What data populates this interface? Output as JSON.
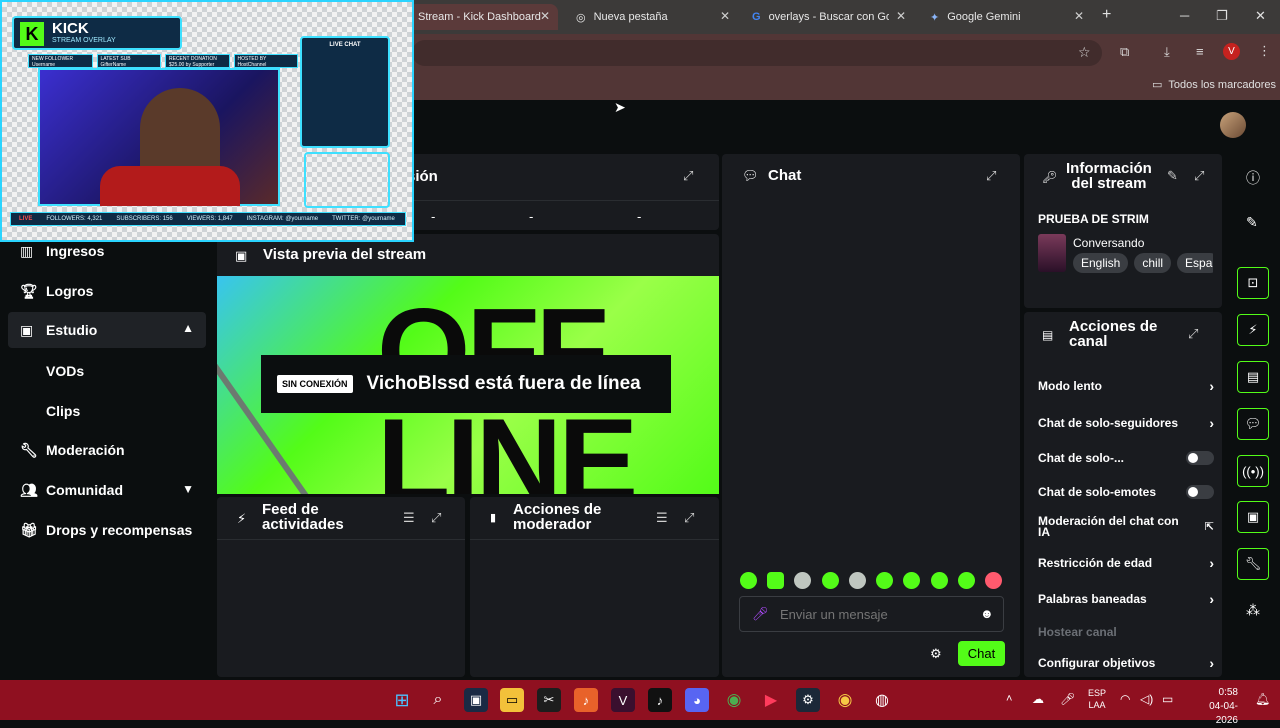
{
  "browser": {
    "tabs": [
      {
        "title": "Stream - Kick Dashboard",
        "active": true
      },
      {
        "title": "Nueva pestaña",
        "active": false
      },
      {
        "title": "overlays - Buscar con Goo",
        "active": false
      },
      {
        "title": "Google Gemini",
        "active": false
      }
    ],
    "new_tab": "+",
    "bookmarks_label": "Todos los marcadores",
    "profile_initial": "V"
  },
  "sidebar": {
    "items": [
      {
        "label": "Ingresos",
        "icon": "bar-chart-icon"
      },
      {
        "label": "Logros",
        "icon": "trophy-icon"
      },
      {
        "label": "Estudio",
        "icon": "video-icon"
      },
      {
        "label": "VODs"
      },
      {
        "label": "Clips"
      },
      {
        "label": "Moderación",
        "icon": "wrench-icon"
      },
      {
        "label": "Comunidad",
        "icon": "users-icon"
      },
      {
        "label": "Drops y recompensas",
        "icon": "gift-icon"
      }
    ]
  },
  "session": {
    "title_fragment": "sión",
    "stats": [
      "-",
      "-",
      "-"
    ]
  },
  "preview": {
    "title": "Vista previa del stream",
    "badge": "SIN CONEXIÓN",
    "offline_text": "VichoBlssd está fuera de línea"
  },
  "activity": {
    "title_line1": "Feed de",
    "title_line2": "actividades"
  },
  "moderator": {
    "title_line1": "Acciones de",
    "title_line2": "moderador"
  },
  "chat": {
    "title": "Chat",
    "placeholder": "Enviar un mensaje",
    "send_label": "Chat"
  },
  "stream_info": {
    "title_line1": "Información",
    "title_line2": "del stream",
    "stream_title": "PRUEBA DE STRIM",
    "category": "Conversando",
    "tags": [
      "English",
      "chill",
      "Espa"
    ]
  },
  "channel_actions": {
    "title_line1": "Acciones de",
    "title_line2": "canal",
    "rows": [
      {
        "label": "Modo lento",
        "control": "chevron"
      },
      {
        "label": "Chat de solo-seguidores",
        "control": "chevron"
      },
      {
        "label": "Chat de solo-...",
        "control": "toggle"
      },
      {
        "label": "Chat de solo-emotes",
        "control": "toggle"
      },
      {
        "label": "Moderación del chat con IA",
        "control": "external"
      },
      {
        "label": "Restricción de edad",
        "control": "chevron"
      },
      {
        "label": "Palabras baneadas",
        "control": "chevron"
      },
      {
        "label": "Hostear canal",
        "control": "none"
      },
      {
        "label": "Configurar objetivos",
        "control": "chevron"
      }
    ]
  },
  "overlay": {
    "brand": "KICK",
    "subtitle": "STREAM OVERLAY",
    "boxes": [
      {
        "title": "NEW FOLLOWER",
        "value": "Username"
      },
      {
        "title": "LATEST SUB",
        "value": "GifterName"
      },
      {
        "title": "RECENT DONATION",
        "value": "$25.00 by Supporter"
      },
      {
        "title": "HOSTED BY",
        "value": "HostChannel"
      }
    ],
    "chat_title": "LIVE CHAT",
    "live": "LIVE",
    "followers": "FOLLOWERS: 4,321",
    "subscribers": "SUBSCRIBERS: 156",
    "viewers": "VIEWERS: 1,847",
    "instagram": "INSTAGRAM: @yourname",
    "twitter": "TWITTER: @yourname"
  },
  "taskbar": {
    "lang1": "ESP",
    "lang2": "LAA",
    "time": "0:58",
    "date": "04-04-2026"
  },
  "colors": {
    "accent": "#53fc18",
    "panel": "#191b1f",
    "taskbar": "#8f1020"
  }
}
